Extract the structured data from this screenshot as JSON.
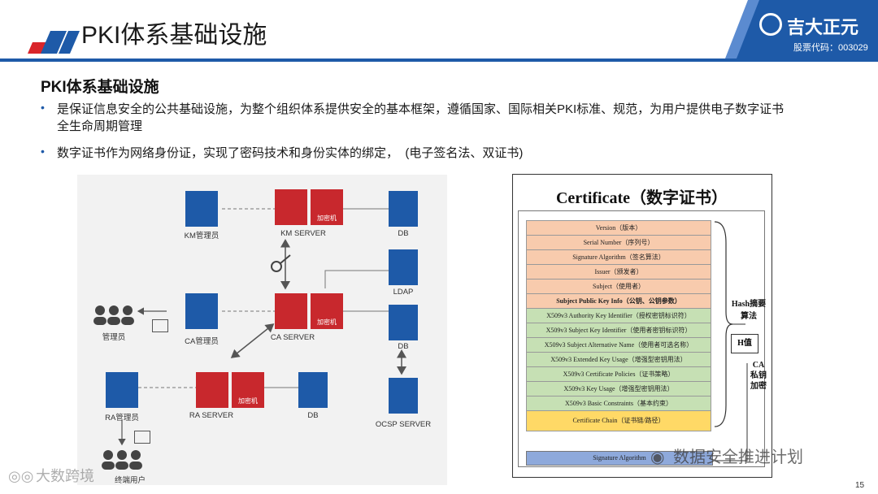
{
  "header": {
    "title": "PKI体系基础设施",
    "logo_name": "吉大正元",
    "logo_code": "股票代码：003029"
  },
  "section": {
    "title": "PKI体系基础设施",
    "bullets": [
      {
        "line1": "是保证信息安全的公共基础设施，为整个组织体系提供安全的基本框架，遵循国家、国际相关PKI标准、规范，为用户提供电子数字证书",
        "line2": "全生命周期管理"
      },
      {
        "line1": "数字证书作为网络身份证，实现了密码技术和身份实体的绑定，  (电子签名法、双证书)",
        "line2": ""
      }
    ]
  },
  "diagram": {
    "km_admin": "KM管理员",
    "km_server": "KM  SERVER",
    "db_top": "DB",
    "ldap": "LDAP",
    "admin": "管理员",
    "ca_admin": "CA管理员",
    "ca_server": "CA  SERVER",
    "db_mid": "DB",
    "ra_admin": "RA管理员",
    "ra_server": "RA  SERVER",
    "db_bottom": "DB",
    "ocsp": "OCSP SERVER",
    "user": "终端用户",
    "encrypt": "加密机"
  },
  "certificate": {
    "title": "Certificate（数字证书）",
    "rows": [
      "Version（版本）",
      "Serial Number（序列号）",
      "Signature Algorithm（签名算法）",
      "Issuer（颁发者）",
      "Subject（使用者）",
      "Subject Public Key Info（公钥、公钥参数）",
      "X509v3 Authority Key Identifier（授权密钥标识符）",
      "X509v3 Subject Key Identifier（使用者密钥标识符）",
      "X509v3 Subject Alternative Name（使用者可选名称）",
      "X509v3 Extended Key Usage（增强型密钥用法）",
      "X509v3 Certificate Policies（证书策略）",
      "X509v3 Key Usage（增强型密钥用法）",
      "X509v3 Basic Constraints（基本约束）",
      "Certificate Chain（证书链/路径）"
    ],
    "signature": "Signature Algorithm",
    "hash_label_1": "Hash摘要",
    "hash_label_2": "算法",
    "h_value": "H值",
    "ca_label_1": "CA",
    "ca_label_2": "私钥",
    "ca_label_3": "加密"
  },
  "watermarks": {
    "left": "大数跨境",
    "right": "数据安全推进计划"
  },
  "page_number": "15",
  "colors": {
    "brand_blue": "#1e5aa8",
    "server_red": "#c8282d",
    "cert_orange": "#f8cbad",
    "cert_green": "#c6e0b4",
    "cert_yellow": "#ffd966",
    "cert_sig": "#8ea9db"
  }
}
